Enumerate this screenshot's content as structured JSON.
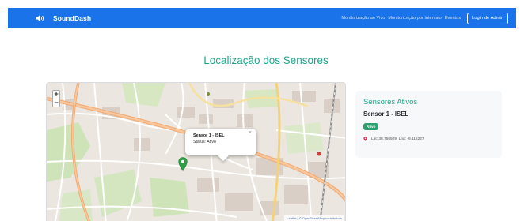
{
  "navbar": {
    "brand": "SoundDash",
    "brand_icon": "speaker-icon",
    "links": [
      "Monitorização ao Vivo",
      "Monitorização por Intervalo",
      "Eventos"
    ],
    "login_label": "Login de Admin",
    "color": "#1a73e8"
  },
  "page": {
    "title": "Localização dos Sensores",
    "accent": "#1fa58d"
  },
  "map": {
    "zoom_in": "+",
    "zoom_out": "−",
    "popup": {
      "title": "Sensor 1 - ISEL",
      "status": "Status: Ativo",
      "close": "×"
    },
    "marker_icon": "map-marker-icon",
    "attribution": "Leaflet | © OpenStreetMap contributors"
  },
  "sidebar": {
    "title": "Sensores Ativos",
    "sensor": {
      "name": "Sensor 1 - ISEL",
      "badge": "Ativo",
      "badge_color": "#2e9f6e",
      "coords": "Lat: 38.756509, Lng: -9.116227",
      "pin_icon": "location-pin-icon"
    }
  }
}
